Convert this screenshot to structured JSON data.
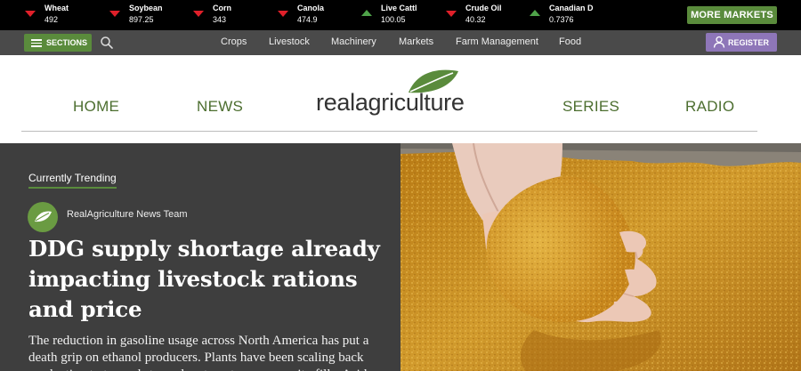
{
  "ticker": [
    {
      "name": "Wheat",
      "value": "492",
      "trend": "down"
    },
    {
      "name": "Soybean",
      "value": "897.25",
      "trend": "down"
    },
    {
      "name": "Corn",
      "value": "343",
      "trend": "down"
    },
    {
      "name": "Canola",
      "value": "474.9",
      "trend": "down"
    },
    {
      "name": "Live Cattl",
      "value": "100.05",
      "trend": "up"
    },
    {
      "name": "Crude Oil",
      "value": "40.32",
      "trend": "down"
    },
    {
      "name": "Canadian D",
      "value": "0.7376",
      "trend": "up"
    }
  ],
  "more_markets_label": "MORE MARKETS",
  "navbar": {
    "sections_label": "SECTIONS",
    "links": [
      "Crops",
      "Livestock",
      "Machinery",
      "Markets",
      "Farm Management",
      "Food"
    ],
    "register_label": "REGISTER"
  },
  "header": {
    "logo_text": "realagriculture",
    "nav": [
      "HOME",
      "NEWS",
      "SERIES",
      "RADIO"
    ]
  },
  "hero": {
    "trending_label": "Currently Trending",
    "author": "RealAgriculture News Team",
    "headline": "DDG supply shortage already impacting livestock rations and price",
    "excerpt": "The reduction in gasoline usage across North America has put a death grip on ethanol producers. Plants have been scaling back production to try and stay solvent as storage capacity fills. Aside"
  },
  "colors": {
    "accent_green": "#5a8b3c",
    "register_purple": "#8e76b8",
    "down_red": "#e0202a",
    "up_green": "#4fa34a"
  }
}
